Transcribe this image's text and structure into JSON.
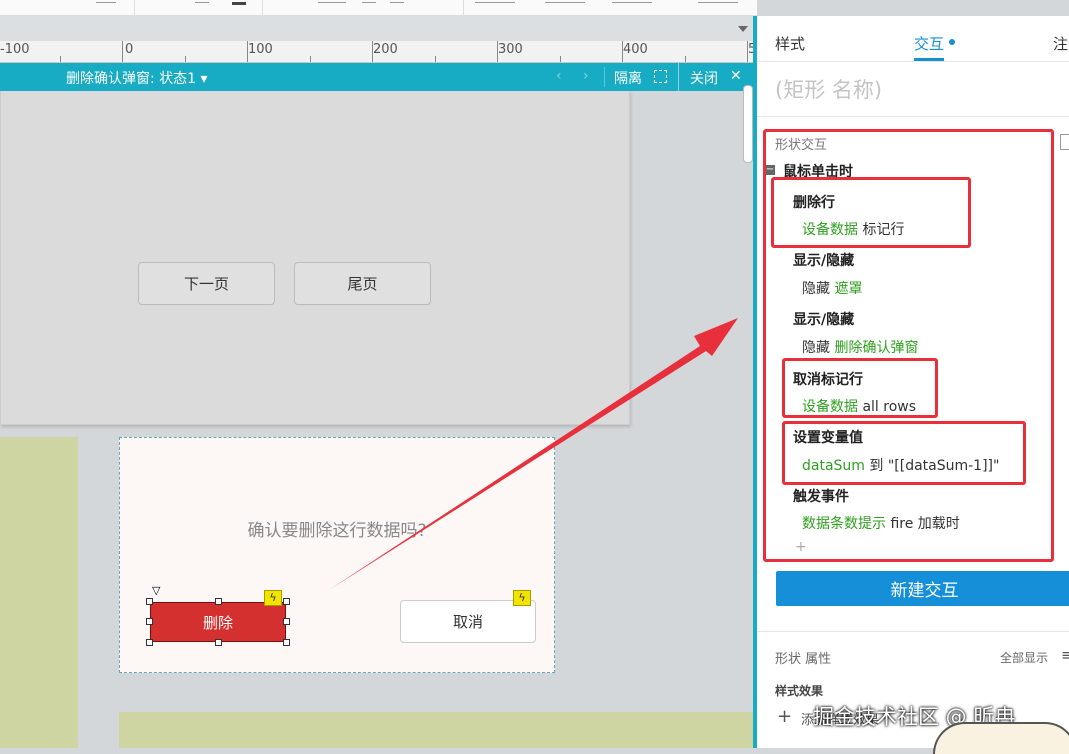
{
  "ruler": {
    "labels": [
      "-100",
      "0",
      "100",
      "200",
      "300",
      "400",
      "5"
    ]
  },
  "panel_bar": {
    "title": "删除确认弹窗: 状态1 ▾",
    "isolate": "隔离",
    "close": "关闭",
    "close_x": "✕"
  },
  "canvas": {
    "next_page": "下一页",
    "last_page": "尾页",
    "confirm_text": "确认要删除这行数据吗?",
    "delete_label": "删除",
    "cancel_label": "取消"
  },
  "right_panel": {
    "tabs": [
      "样式",
      "交互",
      "注"
    ],
    "shape_name_placeholder": "(矩形 名称)",
    "section_title": "形状交互",
    "event_title": "鼠标单击时",
    "actions": [
      {
        "title": "删除行",
        "target": "设备数据",
        "detail": "标记行"
      },
      {
        "title": "显示/隐藏",
        "prefix": "隐藏",
        "target": "遮罩"
      },
      {
        "title": "显示/隐藏",
        "prefix": "隐藏",
        "target": "删除确认弹窗"
      },
      {
        "title": "取消标记行",
        "target": "设备数据",
        "detail": "all rows"
      },
      {
        "title": "设置变量值",
        "target": "dataSum",
        "detail": "到 \"[[dataSum-1]]\""
      },
      {
        "title": "触发事件",
        "target": "数据条数提示",
        "detail": "fire 加载时"
      }
    ],
    "add_symbol": "+",
    "new_interaction": "新建交互",
    "shape_props": "形状 属性",
    "show_all": "全部显示",
    "style_effects": "样式效果",
    "add_style": "添加样式效果",
    "watermark": "掘金技术社区 @ 昕冉"
  },
  "colors": {
    "accent": "#17abc4",
    "primary": "#1590d8",
    "danger": "#d3302f",
    "highlight": "#e8303c",
    "green": "#2ea01e"
  }
}
